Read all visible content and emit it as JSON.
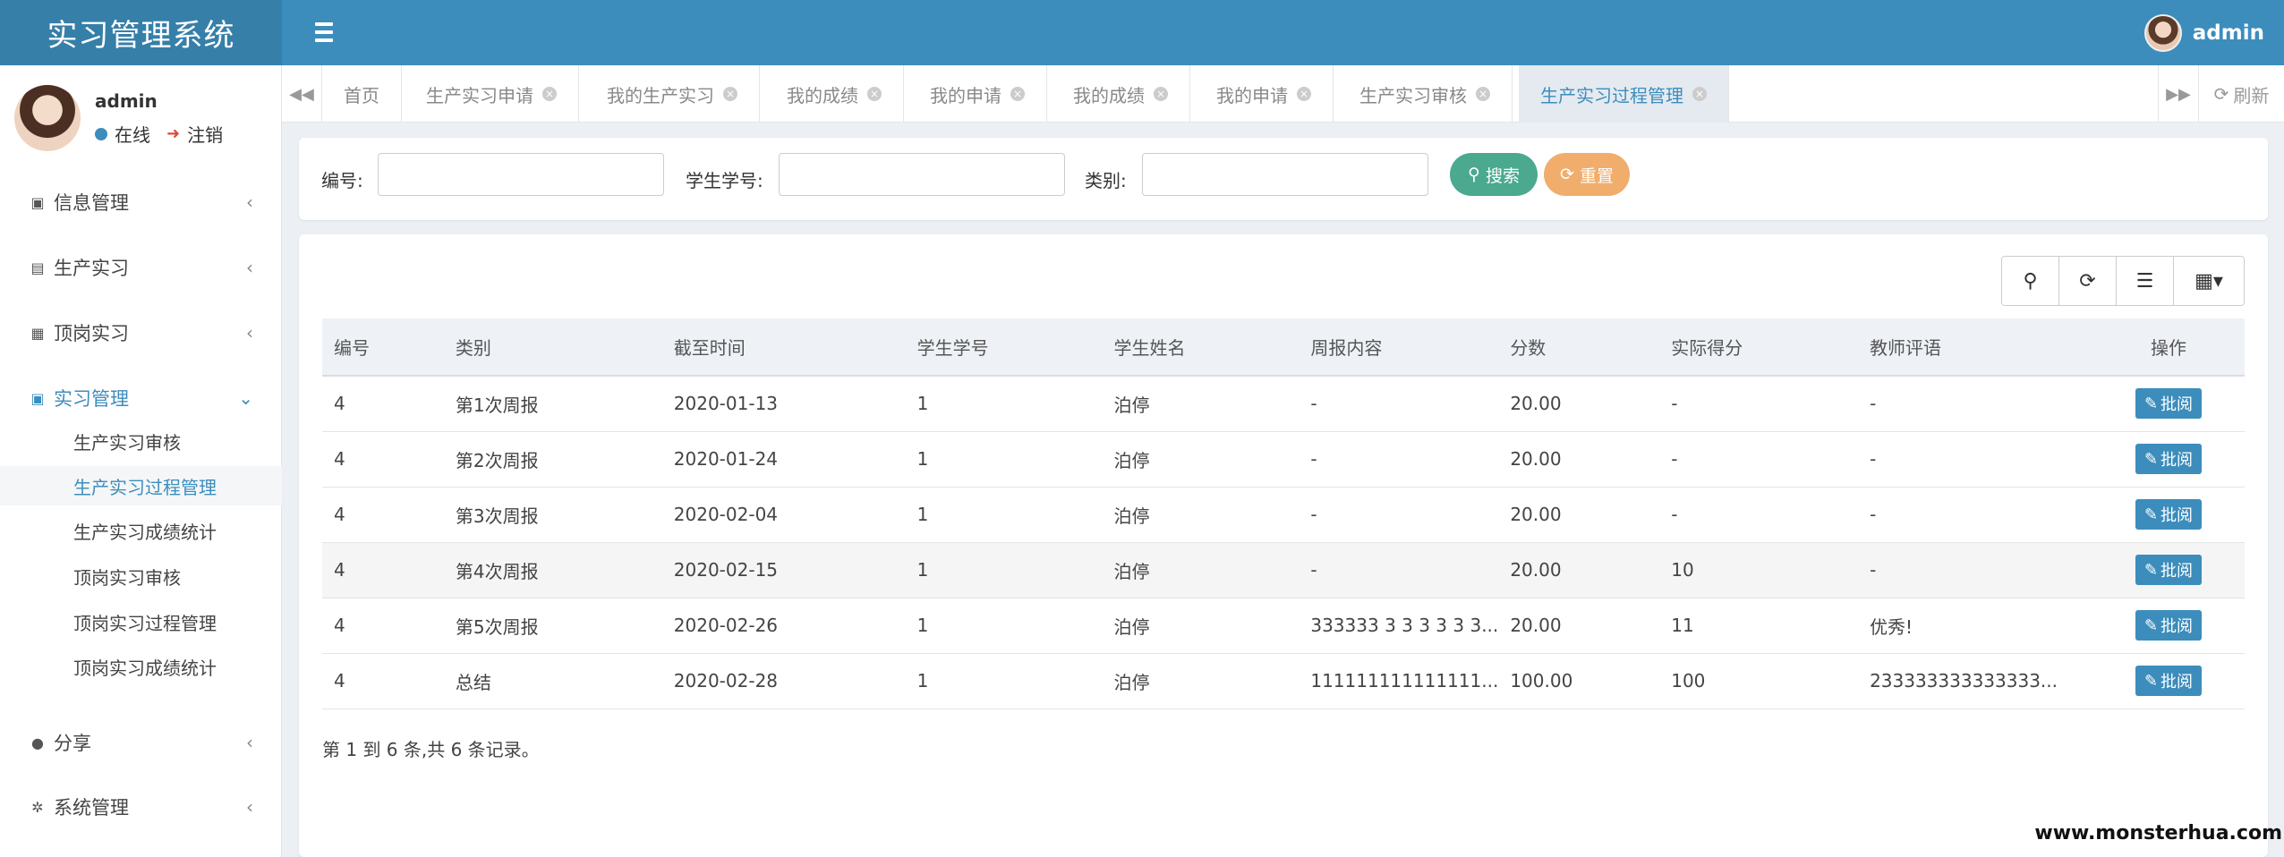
{
  "header": {
    "app_title": "实习管理系统",
    "user_name": "admin"
  },
  "sidebar": {
    "user": {
      "name": "admin",
      "status": "在线",
      "logout": "注销"
    },
    "menu": [
      {
        "label": "信息管理"
      },
      {
        "label": "生产实习"
      },
      {
        "label": "顶岗实习"
      },
      {
        "label": "实习管理"
      },
      {
        "label": "分享"
      },
      {
        "label": "系统管理"
      }
    ],
    "submenu": [
      {
        "label": "生产实习审核"
      },
      {
        "label": "生产实习过程管理"
      },
      {
        "label": "生产实习成绩统计"
      },
      {
        "label": "顶岗实习审核"
      },
      {
        "label": "顶岗实习过程管理"
      },
      {
        "label": "顶岗实习成绩统计"
      }
    ]
  },
  "tabs": [
    {
      "label": "首页"
    },
    {
      "label": "生产实习申请"
    },
    {
      "label": "我的生产实习"
    },
    {
      "label": "我的成绩"
    },
    {
      "label": "我的申请"
    },
    {
      "label": "我的成绩"
    },
    {
      "label": "我的申请"
    },
    {
      "label": "生产实习审核"
    },
    {
      "label": "生产实习过程管理"
    }
  ],
  "refresh_label": "刷新",
  "search": {
    "id_label": "编号:",
    "student_no_label": "学生学号:",
    "category_label": "类别:",
    "search_button": "搜索",
    "reset_button": "重置"
  },
  "table": {
    "headers": [
      "编号",
      "类别",
      "截至时间",
      "学生学号",
      "学生姓名",
      "周报内容",
      "分数",
      "实际得分",
      "教师评语",
      "操作"
    ],
    "rows": [
      [
        "4",
        "第1次周报",
        "2020-01-13",
        "1",
        "泊停",
        "-",
        "20.00",
        "-",
        "-"
      ],
      [
        "4",
        "第2次周报",
        "2020-01-24",
        "1",
        "泊停",
        "-",
        "20.00",
        "-",
        "-"
      ],
      [
        "4",
        "第3次周报",
        "2020-02-04",
        "1",
        "泊停",
        "-",
        "20.00",
        "-",
        "-"
      ],
      [
        "4",
        "第4次周报",
        "2020-02-15",
        "1",
        "泊停",
        "-",
        "20.00",
        "10",
        "-"
      ],
      [
        "4",
        "第5次周报",
        "2020-02-26",
        "1",
        "泊停",
        "333333 3 3 3 3 3 3...",
        "20.00",
        "11",
        "优秀!"
      ],
      [
        "4",
        "总结",
        "2020-02-28",
        "1",
        "泊停",
        "111111111111111...",
        "100.00",
        "100",
        "233333333333333..."
      ]
    ],
    "action_label": "批阅",
    "footer": "第 1 到 6 条,共 6 条记录。"
  },
  "watermark": "www.monsterhua.com"
}
